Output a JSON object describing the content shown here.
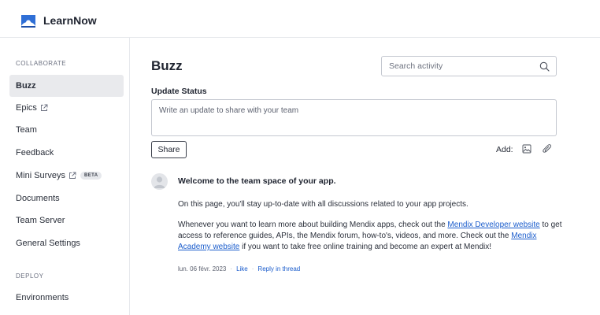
{
  "app": {
    "title": "LearnNow"
  },
  "sidebar": {
    "collaborate_label": "COLLABORATE",
    "items": [
      {
        "label": "Buzz"
      },
      {
        "label": "Epics"
      },
      {
        "label": "Team"
      },
      {
        "label": "Feedback"
      },
      {
        "label": "Mini Surveys",
        "badge": "BETA"
      },
      {
        "label": "Documents"
      },
      {
        "label": "Team Server"
      },
      {
        "label": "General Settings"
      }
    ],
    "deploy_label": "DEPLOY",
    "deploy_items": [
      {
        "label": "Environments"
      }
    ]
  },
  "main": {
    "title": "Buzz",
    "search": {
      "placeholder": "Search activity"
    },
    "update": {
      "label": "Update Status",
      "placeholder": "Write an update to share with your team",
      "share_label": "Share",
      "add_label": "Add:"
    },
    "post": {
      "title": "Welcome to the team space of your app.",
      "para1": "On this page, you'll stay up-to-date with all discussions related to your app projects.",
      "para2_a": "Whenever you want to learn more about building Mendix apps, check out the ",
      "link1": "Mendix Developer website",
      "para2_b": " to get access to reference guides, APIs, the Mendix forum, how-to's, videos, and more. Check out the ",
      "link2": "Mendix Academy website",
      "para2_c": " if you want to take free online training and become an expert at Mendix!",
      "date": "lun. 06 févr. 2023",
      "like": "Like",
      "reply": "Reply in thread"
    }
  },
  "colors": {
    "accent": "#1a5ccc",
    "logo": "#2f6fd6",
    "active_nav": "#e9eaed"
  },
  "icons": [
    "logo-icon",
    "external-link-icon",
    "search-icon",
    "image-icon",
    "paperclip-icon",
    "avatar"
  ]
}
